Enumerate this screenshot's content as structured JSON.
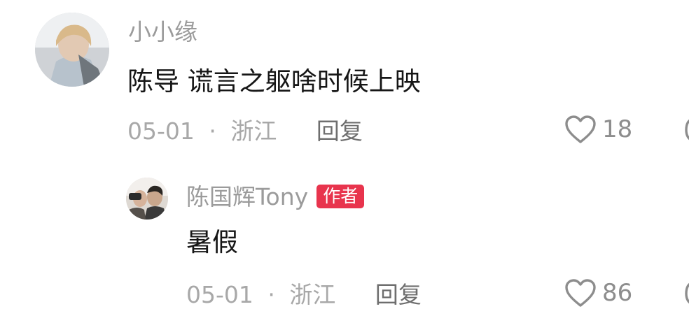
{
  "comments": [
    {
      "username": "小小缘",
      "text": "陈导 谎言之躯啥时候上映",
      "date": "05-01",
      "separator": "·",
      "location": "浙江",
      "reply_label": "回复",
      "like_icon": "heart-outline-icon",
      "likes": "18",
      "replies": [
        {
          "username": "陈国辉Tony",
          "badge": "作者",
          "badge_color": "#e8344d",
          "text": "暑假",
          "date": "05-01",
          "separator": "·",
          "location": "浙江",
          "reply_label": "回复",
          "like_icon": "heart-outline-icon",
          "likes": "86"
        }
      ]
    }
  ]
}
